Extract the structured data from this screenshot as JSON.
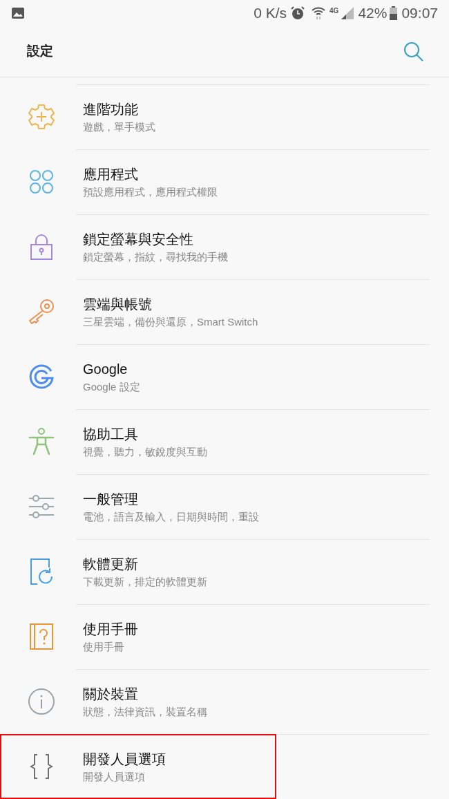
{
  "status_bar": {
    "speed": "0 K/s",
    "network": "4G",
    "battery": "42%",
    "time": "09:07"
  },
  "app_bar": {
    "title": "設定"
  },
  "items": [
    {
      "kind": "advanced",
      "color": "#f0b550",
      "title": "進階功能",
      "subtitle": "遊戲，單手模式",
      "highlighted": false
    },
    {
      "kind": "apps",
      "color": "#5bb4e0",
      "title": "應用程式",
      "subtitle": "預設應用程式，應用程式權限",
      "highlighted": false
    },
    {
      "kind": "lock",
      "color": "#a58ae0",
      "title": "鎖定螢幕與安全性",
      "subtitle": "鎖定螢幕，指紋，尋找我的手機",
      "highlighted": false
    },
    {
      "kind": "key",
      "color": "#f09050",
      "title": "雲端與帳號",
      "subtitle": "三星雲端，備份與還原，Smart Switch",
      "highlighted": false
    },
    {
      "kind": "google",
      "color": "#4f8ee8",
      "title": "Google",
      "subtitle": "Google 設定",
      "highlighted": false
    },
    {
      "kind": "accessibility",
      "color": "#8cc47a",
      "title": "協助工具",
      "subtitle": "視覺，聽力，敏銳度與互動",
      "highlighted": false
    },
    {
      "kind": "general",
      "color": "#9aa8b0",
      "title": "一般管理",
      "subtitle": "電池，語言及輸入，日期與時間，重設",
      "highlighted": false
    },
    {
      "kind": "update",
      "color": "#4a9ee8",
      "title": "軟體更新",
      "subtitle": "下載更新，排定的軟體更新",
      "highlighted": false
    },
    {
      "kind": "manual",
      "color": "#e8953a",
      "title": "使用手冊",
      "subtitle": "使用手冊",
      "highlighted": false
    },
    {
      "kind": "about",
      "color": "#9aa4a8",
      "title": "關於裝置",
      "subtitle": "狀態，法律資訊，裝置名稱",
      "highlighted": false
    },
    {
      "kind": "developer",
      "color": "#707070",
      "title": "開發人員選項",
      "subtitle": "開發人員選項",
      "highlighted": true
    }
  ]
}
